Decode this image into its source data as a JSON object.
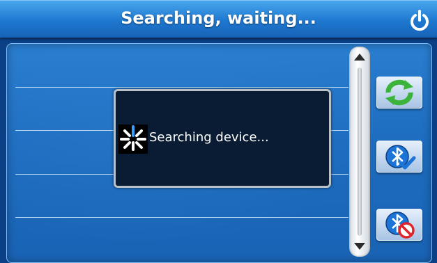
{
  "header": {
    "title": "Searching, waiting...",
    "power_icon": "power-icon"
  },
  "dialog": {
    "message": "Searching device...",
    "spinner_icon": "loading-spinner-icon"
  },
  "side_buttons": [
    {
      "name": "refresh-button",
      "icon": "refresh-icon"
    },
    {
      "name": "bluetooth-connect-button",
      "icon": "bluetooth-check-icon"
    },
    {
      "name": "bluetooth-disconnect-button",
      "icon": "bluetooth-cancel-icon"
    }
  ],
  "colors": {
    "header": "#1f78d0",
    "panel": "#1d6cbf",
    "dialog": "#0a1c33",
    "refresh_green": "#3cb43c",
    "cancel_red": "#e0242a",
    "bluetooth_blue": "#1c74d6"
  }
}
